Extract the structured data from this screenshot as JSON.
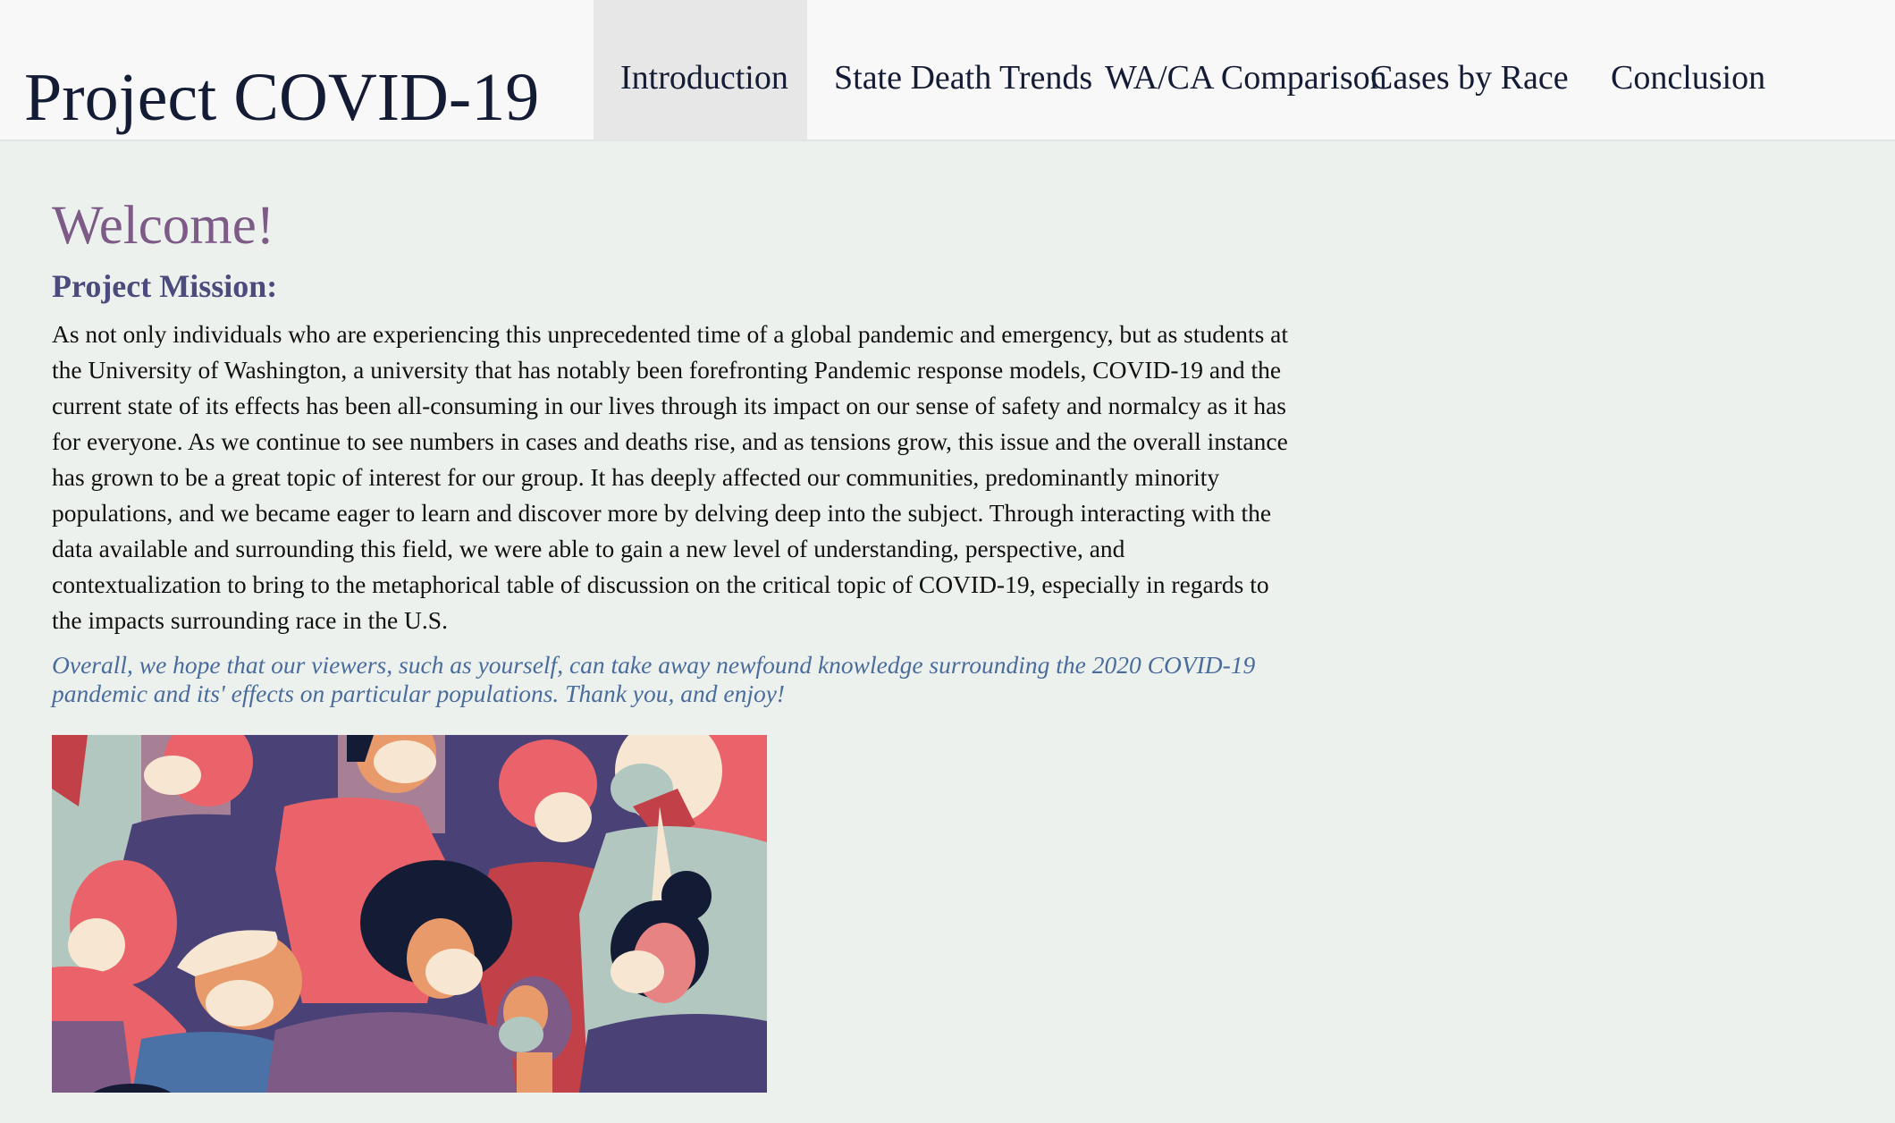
{
  "header": {
    "brand": "Project COVID-19",
    "nav": [
      {
        "label": "Introduction",
        "active": true
      },
      {
        "label": "State Death Trends",
        "active": false
      },
      {
        "label": "WA/CA Comparison",
        "active": false
      },
      {
        "label": "Cases by Race",
        "active": false
      },
      {
        "label": "Conclusion",
        "active": false
      }
    ]
  },
  "main": {
    "heading": "Welcome!",
    "subheading": "Project Mission:",
    "mission_text": "As not only individuals who are experiencing this unprecedented time of a global pandemic and emergency, but as students at the University of Washington, a university that has notably been forefronting Pandemic response models, COVID-19 and the current state of its effects has been all-consuming in our lives through its impact on our sense of safety and normalcy as it has for everyone. As we continue to see numbers in cases and deaths rise, and as tensions grow, this issue and the overall instance has grown to be a great topic of interest for our group. It has deeply affected our communities, predominantly minority populations, and we became eager to learn and discover more by delving deep into the subject. Through interacting with the data available and surrounding this field, we were able to gain a new level of understanding, perspective, and contextualization to bring to the metaphorical table of discussion on the critical topic of COVID-19, especially in regards to the impacts surrounding race in the U.S.",
    "closing_text": "Overall, we hope that our viewers, such as yourself, can take away newfound knowledge surrounding the 2020 COVID-19 pandemic and its' effects on particular populations. Thank you, and enjoy!",
    "illustration": "crowd-wearing-masks-illustration"
  },
  "colors": {
    "page_bg": "#ecf1ee",
    "navbar_bg": "#f8f8f8",
    "active_tab_bg": "#e7e7e7",
    "heading": "#7d5b86",
    "subheading": "#4b4b7d",
    "closing": "#4a6c9c"
  }
}
